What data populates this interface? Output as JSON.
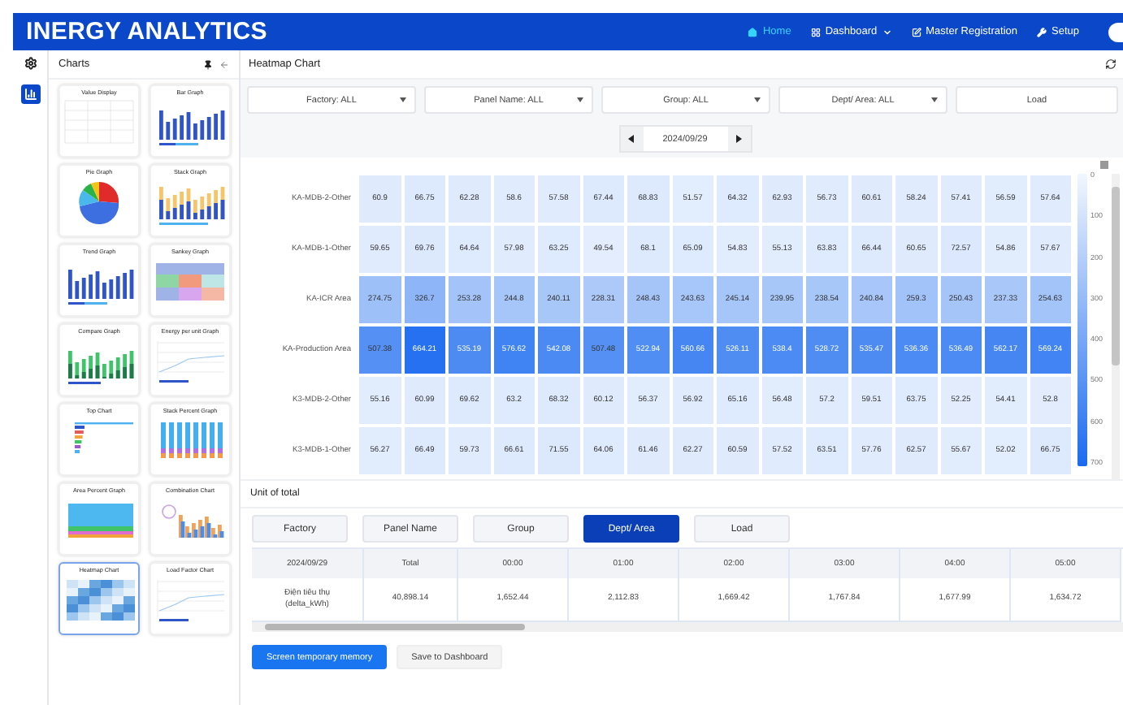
{
  "header": {
    "logo": "INERGY ANALYTICS",
    "nav": [
      {
        "label": "Home",
        "kind": "home",
        "dropdown": false,
        "selected": true
      },
      {
        "label": "Dashboard",
        "kind": "grid",
        "dropdown": true,
        "selected": false
      },
      {
        "label": "Master Registration",
        "kind": "edit",
        "dropdown": false,
        "selected": false
      },
      {
        "label": "Setup",
        "kind": "wrench",
        "dropdown": false,
        "selected": false
      }
    ]
  },
  "charts_panel": {
    "title": "Charts",
    "items": [
      {
        "title": "Value Display",
        "kind": "table",
        "selected": false
      },
      {
        "title": "Bar Graph",
        "kind": "bar",
        "selected": false
      },
      {
        "title": "Pie Graph",
        "kind": "pie",
        "selected": false
      },
      {
        "title": "Stack Graph",
        "kind": "stack",
        "selected": false
      },
      {
        "title": "Trend Graph",
        "kind": "bar",
        "selected": false
      },
      {
        "title": "Sankey Graph",
        "kind": "sankey",
        "selected": false
      },
      {
        "title": "Compare Graph",
        "kind": "compare",
        "selected": false
      },
      {
        "title": "Energy per unit Graph",
        "kind": "line",
        "selected": false
      },
      {
        "title": "Top Chart",
        "kind": "top",
        "selected": false
      },
      {
        "title": "Stack Percent Graph",
        "kind": "stackpct",
        "selected": false
      },
      {
        "title": "Area Percent Graph",
        "kind": "area",
        "selected": false
      },
      {
        "title": "Combination Chart",
        "kind": "combo",
        "selected": false
      },
      {
        "title": "Heatmap Chart",
        "kind": "heatmap",
        "selected": true
      },
      {
        "title": "Load Factor Chart",
        "kind": "line",
        "selected": false
      }
    ]
  },
  "main": {
    "title": "Heatmap Chart",
    "filters": [
      {
        "label": "Factory: ALL"
      },
      {
        "label": "Panel Name: ALL"
      },
      {
        "label": "Group: ALL"
      },
      {
        "label": "Dept/ Area: ALL"
      }
    ],
    "load_button": "Load",
    "date": "2024/09/29",
    "heatmap": {
      "rows": [
        {
          "label": "KA-MDB-2-Other",
          "values": [
            "60.9",
            "66.75",
            "62.28",
            "58.6",
            "57.58",
            "67.44",
            "68.83",
            "51.57",
            "64.32",
            "62.93",
            "56.73",
            "60.61",
            "58.24",
            "57.41",
            "56.59",
            "57.64"
          ]
        },
        {
          "label": "KA-MDB-1-Other",
          "values": [
            "59.65",
            "69.76",
            "64.64",
            "57.98",
            "63.25",
            "49.54",
            "68.1",
            "65.09",
            "54.83",
            "55.13",
            "63.83",
            "66.44",
            "60.65",
            "72.57",
            "54.86",
            "57.67"
          ]
        },
        {
          "label": "KA-ICR Area",
          "values": [
            "274.75",
            "326.7",
            "253.28",
            "244.8",
            "240.11",
            "228.31",
            "248.43",
            "243.63",
            "245.14",
            "239.95",
            "238.54",
            "240.84",
            "259.3",
            "250.43",
            "237.33",
            "254.63"
          ]
        },
        {
          "label": "KA-Production Area",
          "values": [
            "507.38",
            "664.21",
            "535.19",
            "576.62",
            "542.08",
            "507.48",
            "522.94",
            "560.66",
            "526.11",
            "538.4",
            "528.72",
            "535.47",
            "536.36",
            "536.49",
            "562.17",
            "569.24"
          ]
        },
        {
          "label": "K3-MDB-2-Other",
          "values": [
            "55.16",
            "60.99",
            "69.62",
            "63.2",
            "68.32",
            "60.12",
            "56.37",
            "56.92",
            "65.16",
            "56.48",
            "57.2",
            "59.51",
            "63.75",
            "52.25",
            "54.41",
            "52.8"
          ]
        },
        {
          "label": "K3-MDB-1-Other",
          "values": [
            "56.27",
            "66.49",
            "59.73",
            "66.61",
            "71.55",
            "64.06",
            "61.46",
            "62.27",
            "60.59",
            "57.52",
            "63.51",
            "57.76",
            "62.57",
            "55.67",
            "52.02",
            "66.75"
          ]
        }
      ],
      "legend": [
        "0",
        "100",
        "200",
        "300",
        "400",
        "500",
        "600",
        "700"
      ]
    },
    "unit_label": "Unit of total",
    "level_tabs": [
      {
        "label": "Factory",
        "selected": false
      },
      {
        "label": "Panel Name",
        "selected": false
      },
      {
        "label": "Group",
        "selected": false
      },
      {
        "label": "Dept/ Area",
        "selected": true
      },
      {
        "label": "Load",
        "selected": false
      }
    ],
    "table": {
      "columns": [
        "2024/09/29",
        "Total",
        "00:00",
        "01:00",
        "02:00",
        "03:00",
        "04:00",
        "05:00"
      ],
      "rows": [
        {
          "cells": [
            "Điện tiêu thụ (delta_kWh)",
            "40,898.14",
            "1,652.44",
            "2,112.83",
            "1,669.42",
            "1,767.84",
            "1,677.99",
            "1,634.72"
          ]
        }
      ]
    },
    "buttons": [
      {
        "label": "Screen temporary memory",
        "kind": "primary"
      },
      {
        "label": "Save to Dashboard",
        "kind": "secondary"
      }
    ]
  }
}
